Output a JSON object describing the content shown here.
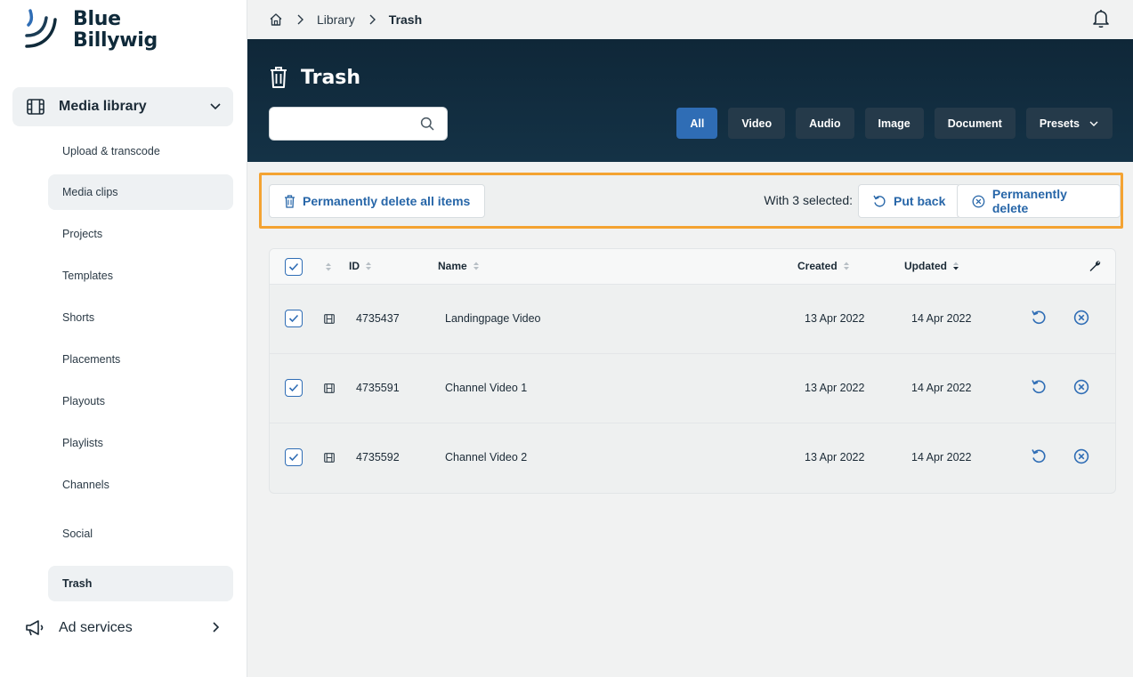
{
  "brand": {
    "line1": "Blue",
    "line2": "Billywig"
  },
  "sidebar": {
    "section": {
      "label": "Media library",
      "icon": "film-icon"
    },
    "items": [
      {
        "label": "Upload & transcode"
      },
      {
        "label": "Media clips"
      },
      {
        "label": "Projects"
      },
      {
        "label": "Templates"
      },
      {
        "label": "Shorts"
      },
      {
        "label": "Placements"
      },
      {
        "label": "Playouts"
      },
      {
        "label": "Playlists"
      },
      {
        "label": "Channels"
      },
      {
        "label": "Social"
      },
      {
        "label": "Trash"
      }
    ],
    "ad_services": {
      "label": "Ad services",
      "icon": "megaphone-icon"
    }
  },
  "breadcrumb": {
    "items": [
      "Library",
      "Trash"
    ]
  },
  "header": {
    "title": "Trash",
    "search": {
      "placeholder": "",
      "value": ""
    },
    "filters": [
      "All",
      "Video",
      "Audio",
      "Image",
      "Document"
    ],
    "presets_label": "Presets",
    "active_filter": "All"
  },
  "actions": {
    "delete_all": "Permanently delete all items",
    "selection_text": "With 3 selected:",
    "put_back": "Put back",
    "permanently_delete": "Permanently delete"
  },
  "table": {
    "columns": {
      "id": "ID",
      "name": "Name",
      "created": "Created",
      "updated": "Updated"
    },
    "rows": [
      {
        "id": "4735437",
        "name": "Landingpage Video",
        "created": "13 Apr 2022",
        "updated": "14 Apr 2022",
        "checked": true
      },
      {
        "id": "4735591",
        "name": "Channel Video 1",
        "created": "13 Apr 2022",
        "updated": "14 Apr 2022",
        "checked": true
      },
      {
        "id": "4735592",
        "name": "Channel Video 2",
        "created": "13 Apr 2022",
        "updated": "14 Apr 2022",
        "checked": true
      }
    ]
  },
  "colors": {
    "accent": "#2f6db5",
    "header_bg": "#0f2738",
    "highlight": "#f4a332",
    "link": "#2766a8"
  }
}
